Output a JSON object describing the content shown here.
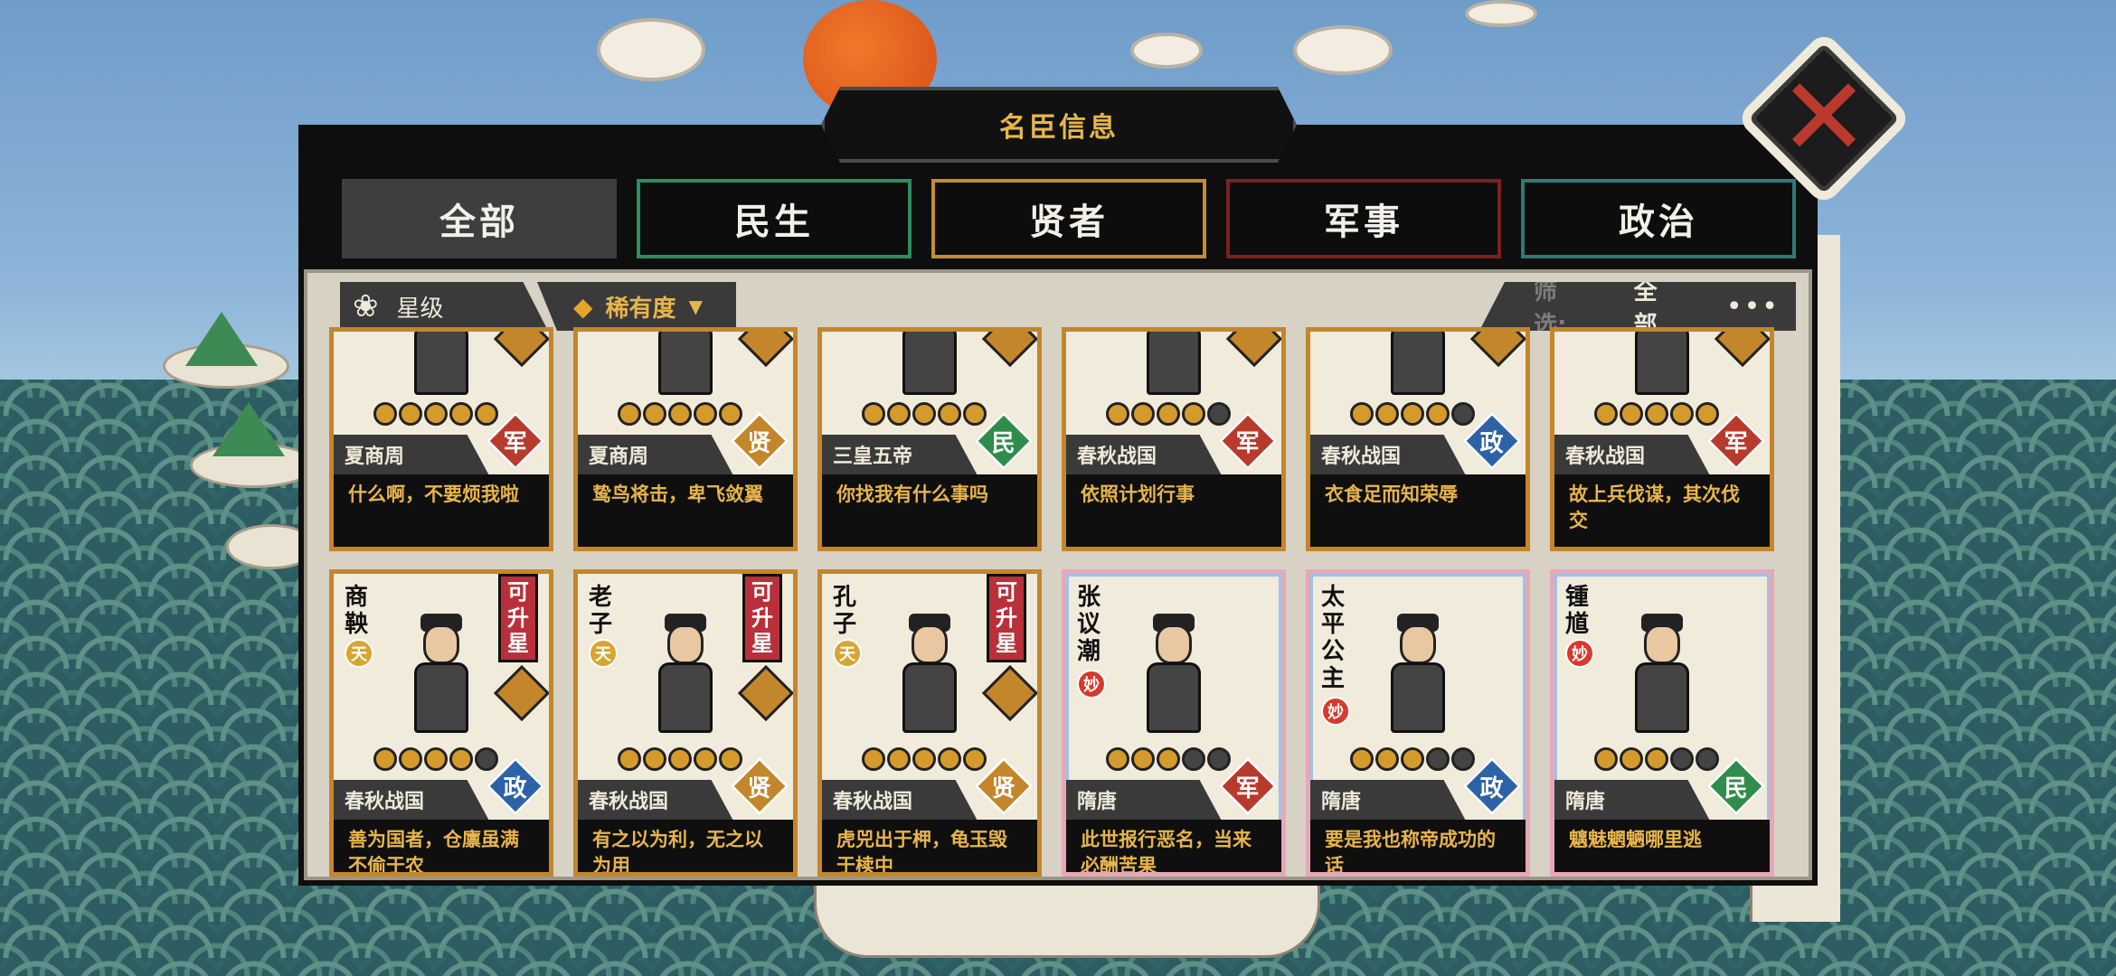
{
  "window": {
    "title": "名臣信息",
    "close_icon": "close-x-icon"
  },
  "tabs": [
    {
      "label": "全部",
      "active": true,
      "color": "#3e3e3e"
    },
    {
      "label": "民生",
      "color": "#2e8d5d"
    },
    {
      "label": "贤者",
      "color": "#c48c2e"
    },
    {
      "label": "军事",
      "color": "#7d2020"
    },
    {
      "label": "政治",
      "color": "#2d7a78"
    }
  ],
  "sort": {
    "star_label": "星级",
    "rarity_label": "稀有度"
  },
  "filter": {
    "label": "筛选:",
    "value": "全部",
    "more": "•••"
  },
  "type_colors": {
    "军": "#b83a2c",
    "贤": "#c4862a",
    "民": "#2f8c4a",
    "政": "#2d62a6"
  },
  "row1": [
    {
      "era": "夏商周",
      "type": "军",
      "stars": 5,
      "quote": "什么啊，不要烦我啦"
    },
    {
      "era": "夏商周",
      "type": "贤",
      "stars": 5,
      "quote": "鸷鸟将击，卑飞敛翼"
    },
    {
      "era": "三皇五帝",
      "type": "民",
      "stars": 5,
      "quote": "你找我有什么事吗"
    },
    {
      "era": "春秋战国",
      "type": "军",
      "stars": 4,
      "quote": "依照计划行事"
    },
    {
      "era": "春秋战国",
      "type": "政",
      "stars": 4,
      "quote": "衣食足而知荣辱"
    },
    {
      "era": "春秋战国",
      "type": "军",
      "stars": 5,
      "quote": "故上兵伐谋，其次伐交"
    }
  ],
  "row2": [
    {
      "name": "商鞅",
      "grade": "天",
      "upgrade": "可升星",
      "era": "春秋战国",
      "type": "政",
      "stars": 4,
      "quote": "善为国者，仓廪虽满不偷于农"
    },
    {
      "name": "老子",
      "grade": "天",
      "upgrade": "可升星",
      "era": "春秋战国",
      "type": "贤",
      "stars": 5,
      "quote": "有之以为利，无之以为用"
    },
    {
      "name": "孔子",
      "grade": "天",
      "upgrade": "可升星",
      "era": "春秋战国",
      "type": "贤",
      "stars": 5,
      "quote": "虎兕出于柙，龟玉毁于椟中"
    },
    {
      "name": "张议潮",
      "grade": "妙",
      "era": "隋唐",
      "type": "军",
      "stars": 3,
      "quote": "此世报行恶名，当来必酬苦果"
    },
    {
      "name": "太平公主",
      "grade": "妙",
      "era": "隋唐",
      "type": "政",
      "stars": 3,
      "quote": "要是我也称帝成功的话"
    },
    {
      "name": "锺馗",
      "grade": "妙",
      "era": "隋唐",
      "type": "民",
      "stars": 3,
      "quote": "魑魅魍魉哪里逃"
    }
  ]
}
